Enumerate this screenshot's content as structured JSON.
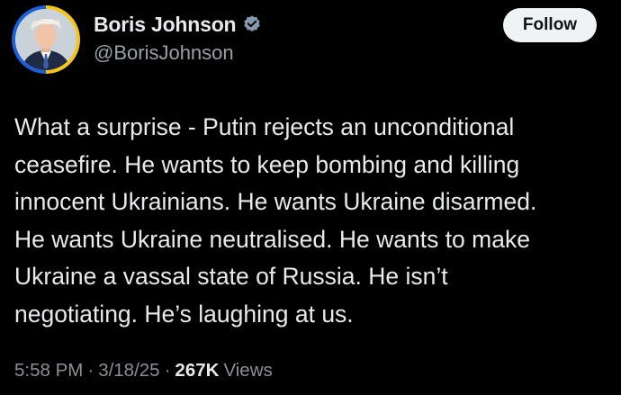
{
  "user": {
    "display_name": "Boris Johnson",
    "handle": "@BorisJohnson",
    "verified_badge_color": "#829aab",
    "avatar_ring_colors": [
      "#f5c518",
      "#1d5fd6"
    ]
  },
  "follow_button": {
    "label": "Follow"
  },
  "tweet": {
    "lines": [
      "What a surprise - Putin rejects an unconditional",
      "ceasefire. He wants to keep bombing and killing",
      "innocent Ukrainians. He wants Ukraine disarmed.",
      "He wants Ukraine neutralised. He wants to make",
      "Ukraine a vassal state of Russia. He isn’t",
      "negotiating. He’s laughing at us."
    ]
  },
  "meta": {
    "time": "5:58 PM",
    "separator": "·",
    "date": "3/18/25",
    "views_count": "267K",
    "views_label": "Views"
  }
}
